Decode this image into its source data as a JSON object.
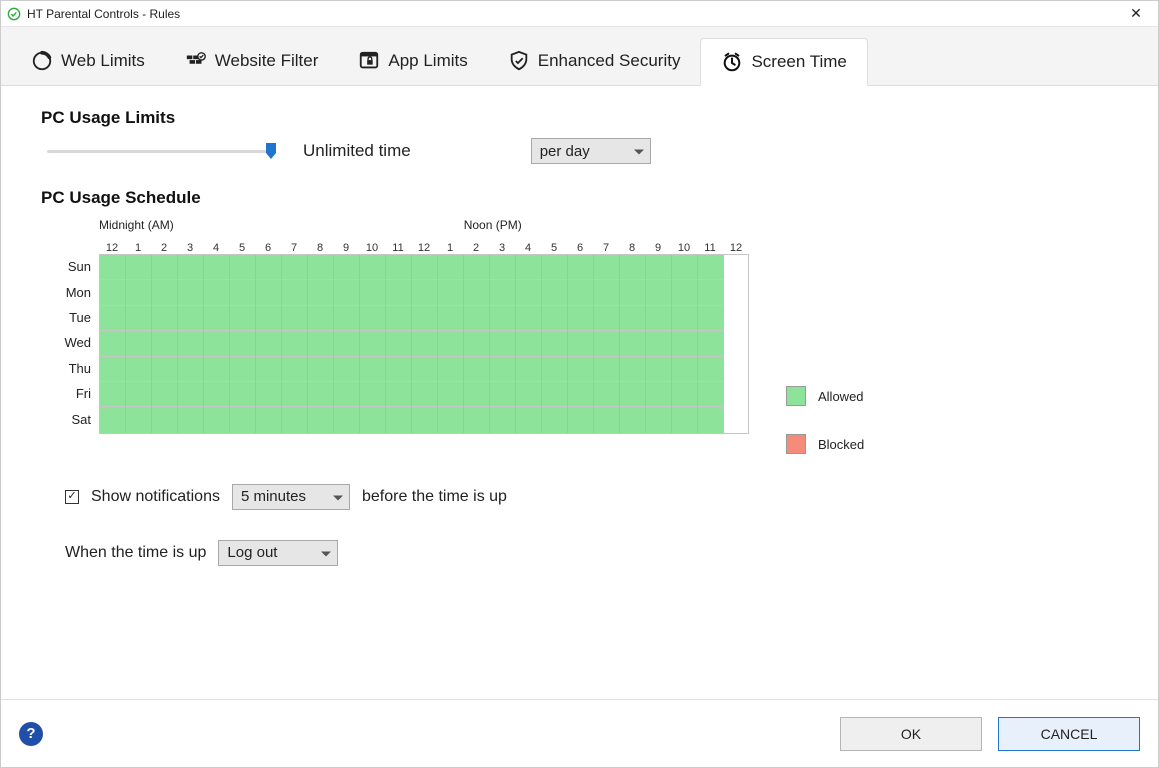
{
  "window": {
    "title": "HT Parental Controls - Rules",
    "close_glyph": "✕"
  },
  "tabs": [
    {
      "label": "Web Limits",
      "icon": "progress-icon",
      "active": false
    },
    {
      "label": "Website Filter",
      "icon": "firewall-icon",
      "active": false
    },
    {
      "label": "App Limits",
      "icon": "app-lock-icon",
      "active": false
    },
    {
      "label": "Enhanced Security",
      "icon": "shield-icon",
      "active": false
    },
    {
      "label": "Screen Time",
      "icon": "clock-icon",
      "active": true
    }
  ],
  "limits": {
    "section_title": "PC Usage Limits",
    "slider_value_label": "Unlimited time",
    "period_select": {
      "value": "per day"
    }
  },
  "schedule": {
    "section_title": "PC Usage Schedule",
    "header_left": "Midnight (AM)",
    "header_right": "Noon (PM)",
    "hours": [
      "12",
      "1",
      "2",
      "3",
      "4",
      "5",
      "6",
      "7",
      "8",
      "9",
      "10",
      "11",
      "12",
      "1",
      "2",
      "3",
      "4",
      "5",
      "6",
      "7",
      "8",
      "9",
      "10",
      "11",
      "12"
    ],
    "days": [
      "Sun",
      "Mon",
      "Tue",
      "Wed",
      "Thu",
      "Fri",
      "Sat"
    ],
    "legend": {
      "allowed": "Allowed",
      "blocked": "Blocked"
    },
    "all_allowed": true
  },
  "options": {
    "show_notifications": {
      "checked": true,
      "label": "Show notifications",
      "value": "5 minutes",
      "suffix": "before the time is up"
    },
    "when_up": {
      "label": "When the time is up",
      "value": "Log out"
    }
  },
  "footer": {
    "help_glyph": "?",
    "ok": "OK",
    "cancel": "CANCEL"
  },
  "colors": {
    "allowed": "#8ee39b",
    "blocked": "#f58b7a",
    "accent": "#1f74d0"
  }
}
